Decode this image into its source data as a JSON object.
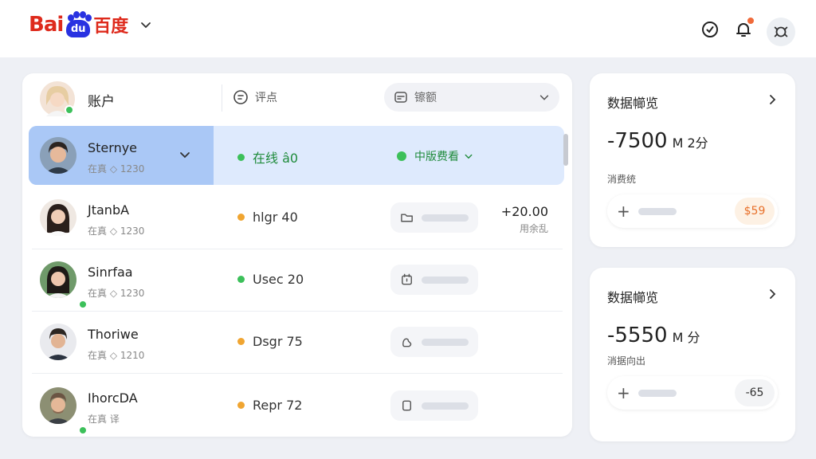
{
  "header": {
    "logo_text": "Bai",
    "logo_paw_text": "du",
    "logo_cn": "百度",
    "icons": [
      "timer-icon",
      "bell-icon",
      "user-swap-icon"
    ]
  },
  "panel": {
    "title": "账户",
    "filter_label": "评点",
    "select_label": "镲额"
  },
  "rows": [
    {
      "name": "Sternye",
      "meta": "在真 ◇ 1230",
      "status": "在线 â0",
      "status_color": "#3cc05a",
      "plan": "中版费看",
      "online": false,
      "selected": true
    },
    {
      "name": "JtanbA",
      "meta": "在真 ◇ 1230",
      "status": "hlgr 40",
      "status_color": "#f0a531",
      "amount": "+20.00",
      "amount_sub": "用余乱",
      "online": false
    },
    {
      "name": "Sinrfaa",
      "meta": "在真 ◇ 1230",
      "status": "Usec 20",
      "status_color": "#3cc05a",
      "online": true
    },
    {
      "name": "Thoriwe",
      "meta": "在真 ◇ 1210",
      "status": "Dsgr 75",
      "status_color": "#f0a531",
      "online": false
    },
    {
      "name": "IhorcDA",
      "meta": "在真 译",
      "status": "Repr 72",
      "status_color": "#f0a531",
      "online": true
    }
  ],
  "cards": [
    {
      "title": "数据幯览",
      "value": "-7500",
      "unit": "M 2分",
      "sub": "消费统",
      "badge": "$59",
      "badge_color": "#e8702a",
      "badge_bg": "#fdf1e4"
    },
    {
      "title": "数据幯览",
      "value": "-5550",
      "unit": "M 分",
      "sub": "消据向出",
      "badge": "-65",
      "badge_color": "#333",
      "badge_bg": "#f3f4f6"
    }
  ],
  "colors": {
    "accent_blue": "#aac8f6",
    "selected_row": "#deeafd",
    "brand_red": "#de2a1c",
    "brand_blue": "#2932e1"
  }
}
